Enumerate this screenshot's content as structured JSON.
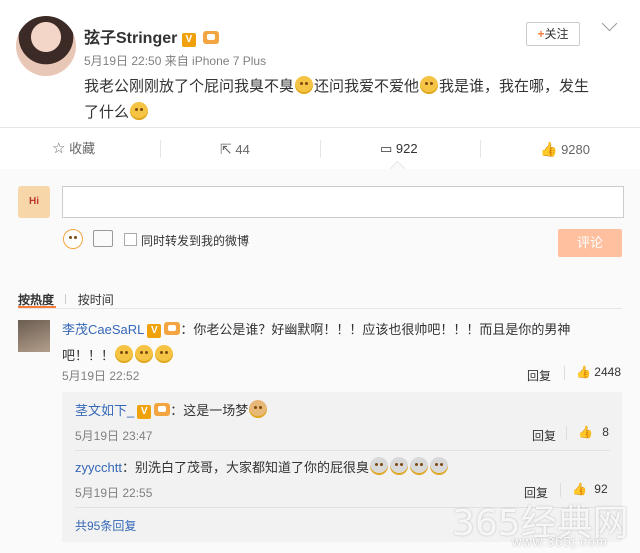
{
  "post": {
    "username": "弦子Stringer",
    "verified_badge": "V",
    "meta": "5月19日 22:50 来自 iPhone 7 Plus",
    "follow_label": "关注",
    "text_line1_a": "我老公刚刚放了个屁问我臭不臭",
    "text_line1_b": "还问我爱不爱他",
    "text_line1_c": "我是谁，我在哪，发生",
    "text_line2": "了什么"
  },
  "actions": {
    "favorite_label": "收藏",
    "share_count": "44",
    "comment_count": "922",
    "like_count": "9280"
  },
  "composer": {
    "checkbox_label": "同时转发到我的微博",
    "submit_label": "评论",
    "avatar_text": "Hi"
  },
  "sort": {
    "hot": "按热度",
    "time": "按时间"
  },
  "comments": [
    {
      "user": "李茂CaeSaRL",
      "text_a": "：你老公是谁？好幽默啊！！！应该也很帅吧！！！而且是你的男神",
      "text_b": "吧！！！",
      "time": "5月19日 22:52",
      "reply_label": "回复",
      "likes": "2448"
    }
  ],
  "replies": [
    {
      "user": "茎文如下_",
      "text": "：这是一场梦",
      "time": "5月19日 23:47",
      "reply_label": "回复",
      "likes": "8"
    },
    {
      "user": "zyycchtt",
      "text": "：别洗白了茂哥，大家都知道了你的屁很臭",
      "time": "5月19日 22:55",
      "reply_label": "回复",
      "likes": "92"
    }
  ],
  "more_replies": "共95条回复",
  "watermark": {
    "main": "365经典网",
    "url": "www.365j.com"
  },
  "colors": {
    "link": "#3668b8",
    "submit_bg": "#ffc09f",
    "orange": "#f77c3d"
  }
}
